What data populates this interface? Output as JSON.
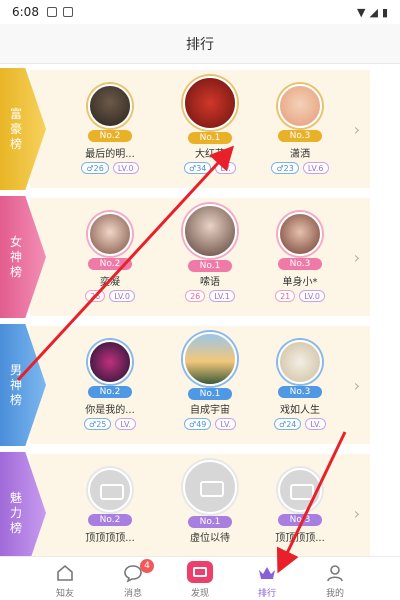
{
  "statusbar": {
    "time": "6:08"
  },
  "header": {
    "title": "排行"
  },
  "rankings": [
    {
      "title": "富豪榜",
      "users": [
        {
          "rank": "No.2",
          "name": "最后的明...",
          "gender": "♂26",
          "level": "LV.0"
        },
        {
          "rank": "No.1",
          "name": "大红花",
          "gender": "♂34",
          "level": "LV."
        },
        {
          "rank": "No.3",
          "name": "潇洒",
          "gender": "♂23",
          "level": "LV.6"
        }
      ]
    },
    {
      "title": "女神榜",
      "users": [
        {
          "rank": "No.2",
          "name": "奕凝",
          "gender": "26",
          "level": "LV.0"
        },
        {
          "rank": "No.1",
          "name": "嗦语",
          "gender": "26",
          "level": "LV.1"
        },
        {
          "rank": "No.3",
          "name": "单身小*",
          "gender": "21",
          "level": "LV.0"
        }
      ]
    },
    {
      "title": "男神榜",
      "users": [
        {
          "rank": "No.2",
          "name": "你是我的...",
          "gender": "♂25",
          "level": "LV."
        },
        {
          "rank": "No.1",
          "name": "自成宇宙",
          "gender": "♂49",
          "level": "LV."
        },
        {
          "rank": "No.3",
          "name": "戏如人生",
          "gender": "♂24",
          "level": "LV."
        }
      ]
    },
    {
      "title": "魅力榜",
      "users": [
        {
          "rank": "No.2",
          "name": "顶顶顶顶...",
          "gender": "",
          "level": ""
        },
        {
          "rank": "No.1",
          "name": "虚位以待",
          "gender": "",
          "level": ""
        },
        {
          "rank": "No.3",
          "name": "顶顶顶顶...",
          "gender": "",
          "level": ""
        }
      ]
    }
  ],
  "tabbar": {
    "tabs": [
      {
        "label": "知友"
      },
      {
        "label": "消息",
        "badge": "4"
      },
      {
        "label": "发现"
      },
      {
        "label": "排行"
      },
      {
        "label": "我的"
      }
    ]
  },
  "colors": {
    "accent_purple": "#8a60d8",
    "annotation_red": "#e8202a",
    "gold": "#e9b128",
    "pink": "#ef7aa8",
    "blue": "#4f98e3",
    "purple": "#a77fe1"
  }
}
